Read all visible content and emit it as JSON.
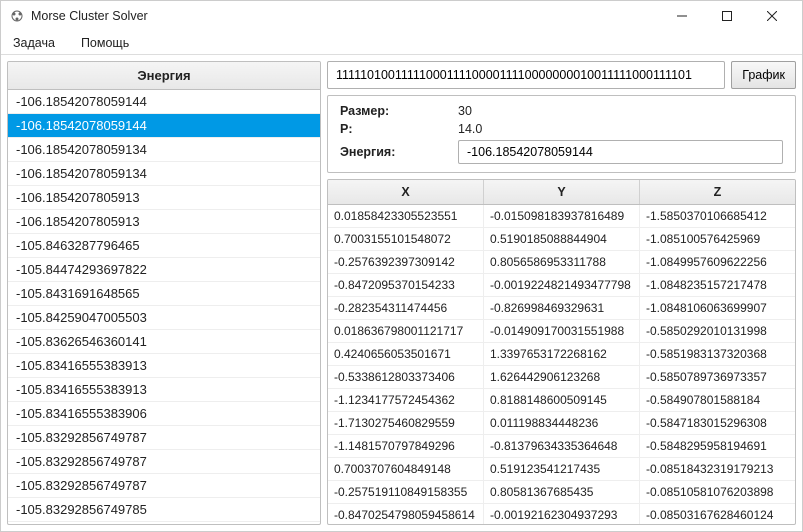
{
  "window": {
    "title": "Morse Cluster Solver"
  },
  "menu": {
    "task": "Задача",
    "help": "Помощь"
  },
  "energy_list": {
    "header": "Энергия",
    "items": [
      "-106.18542078059144",
      "-106.18542078059144",
      "-106.18542078059134",
      "-106.18542078059134",
      "-106.1854207805913",
      "-106.1854207805913",
      "-105.8463287796465",
      "-105.84474293697822",
      "-105.8431691648565",
      "-105.84259047005503",
      "-105.83626546360141",
      "-105.83416555383913",
      "-105.83416555383913",
      "-105.83416555383906",
      "-105.83292856749787",
      "-105.83292856749787",
      "-105.83292856749787",
      "-105.83292856749785"
    ],
    "selected_index": 1
  },
  "top_input": {
    "value": "111110100111110001111000011110000000010011111000111101"
  },
  "buttons": {
    "graph": "График"
  },
  "form": {
    "size_label": "Размер:",
    "size_value": "30",
    "p_label": "P:",
    "p_value": "14.0",
    "energy_label": "Энергия:",
    "energy_value": "-106.18542078059144"
  },
  "table": {
    "columns": [
      "X",
      "Y",
      "Z"
    ],
    "rows": [
      [
        "0.01858423305523551",
        "-0.015098183937816489",
        "-1.5850370106685412"
      ],
      [
        "0.7003155101548072",
        "0.5190185088844904",
        "-1.085100576425969"
      ],
      [
        "-0.2576392397309142",
        "0.8056586953311788",
        "-1.0849957609622256"
      ],
      [
        "-0.8472095370154233",
        "-0.0019224821493477798",
        "-1.0848235157217478"
      ],
      [
        "-0.282354311474456",
        "-0.826998469329631",
        "-1.0848106063699907"
      ],
      [
        "0.018636798001121717",
        "-0.014909170031551988",
        "-0.5850292010131998"
      ],
      [
        "0.4240656053501671",
        "1.3397653172268162",
        "-0.5851983137320368"
      ],
      [
        "-0.5338612803373406",
        "1.626442906123268",
        "-0.5850789736973357"
      ],
      [
        "-1.1234177572454362",
        "0.8188148600509145",
        "-0.584907801588184"
      ],
      [
        "-1.7130275460829559",
        "0.011198834448236",
        "-0.5847183015296308"
      ],
      [
        "-1.1481570797849296",
        "-0.81379634335364648",
        "-0.5848295958194691"
      ],
      [
        "0.7003707604849148",
        "0.519123541217435",
        "-0.08518432319179213"
      ],
      [
        "-0.257519110849158355",
        "0.80581367685435",
        "-0.08510581076203898"
      ],
      [
        "-0.8470254798059458614",
        "-0.00192162304937293",
        "-0.08503167628460124"
      ]
    ]
  }
}
